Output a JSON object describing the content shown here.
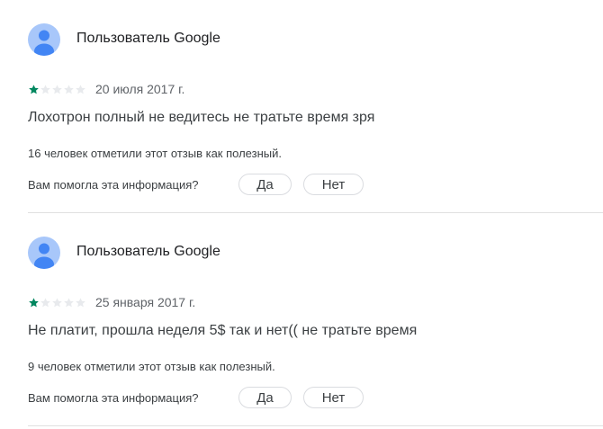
{
  "colors": {
    "star_filled": "#01875f",
    "star_empty": "#e8eaed",
    "avatar_bg": "#a8c7fa",
    "avatar_fg": "#4285f4"
  },
  "reviews": [
    {
      "author": "Пользователь Google",
      "avatar_icon": "default-user-avatar",
      "rating": 1,
      "rating_max": 5,
      "date": "20 июля 2017 г.",
      "text": "Лохотрон полный не ведитесь не тратьте время зря",
      "helpful_count_text": "16 человек отметили этот отзыв как полезный.",
      "helpful_question": "Вам помогла эта информация?",
      "yes_label": "Да",
      "no_label": "Нет"
    },
    {
      "author": "Пользователь Google",
      "avatar_icon": "default-user-avatar",
      "rating": 1,
      "rating_max": 5,
      "date": "25 января 2017 г.",
      "text": "Не платит, прошла неделя 5$ так и нет(( не тратьте время",
      "helpful_count_text": "9 человек отметили этот отзыв как полезный.",
      "helpful_question": "Вам помогла эта информация?",
      "yes_label": "Да",
      "no_label": "Нет"
    }
  ]
}
